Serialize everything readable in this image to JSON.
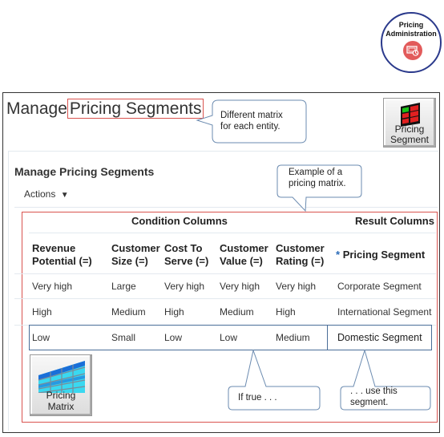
{
  "badge": {
    "title_line1": "Pricing",
    "title_line2": "Administration",
    "icon": "pricing-admin-icon"
  },
  "page": {
    "title_prefix": "Manage",
    "title_highlight": "Pricing Segments"
  },
  "callouts": {
    "entity": {
      "line1": "Different  matrix",
      "line2": "for each entity."
    },
    "matrix": {
      "line1": "Example of a",
      "line2": "pricing matrix."
    },
    "if_true": {
      "text": "If true . . ."
    },
    "use_segment": {
      "line1": ". . . use this",
      "line2": "segment."
    }
  },
  "buttons": {
    "pricing_segment": {
      "line1": "Pricing",
      "line2": "Segment",
      "icon": "pricing-segment-icon"
    },
    "pricing_matrix": {
      "line1": "Pricing",
      "line2": "Matrix",
      "icon": "pricing-matrix-icon"
    }
  },
  "panel": {
    "title": "Manage Pricing Segments",
    "actions_label": "Actions",
    "actions_icon": "caret-down-icon"
  },
  "table": {
    "groups": {
      "condition": "Condition Columns",
      "result": "Result Columns"
    },
    "columns": [
      {
        "line1": "Revenue",
        "line2": "Potential (=)"
      },
      {
        "line1": "Customer",
        "line2": "Size (=)"
      },
      {
        "line1": "Cost To",
        "line2": "Serve (=)"
      },
      {
        "line1": "Customer",
        "line2": "Value (=)"
      },
      {
        "line1": "Customer",
        "line2": "Rating (=)"
      },
      {
        "required_mark": "*",
        "line1": "Pricing Segment"
      }
    ],
    "rows": [
      [
        "Very high",
        "Large",
        "Very high",
        "Very high",
        "Very high",
        "Corporate Segment"
      ],
      [
        "High",
        "Medium",
        "High",
        "Medium",
        "High",
        "International  Segment"
      ],
      [
        "Low",
        "Small",
        "Low",
        "Low",
        "Medium",
        "Domestic Segment"
      ]
    ],
    "highlighted_row": 2
  },
  "colors": {
    "highlight_red": "#d9534f",
    "callout_border": "#6b8bb0",
    "required_blue": "#2a6bb8"
  }
}
